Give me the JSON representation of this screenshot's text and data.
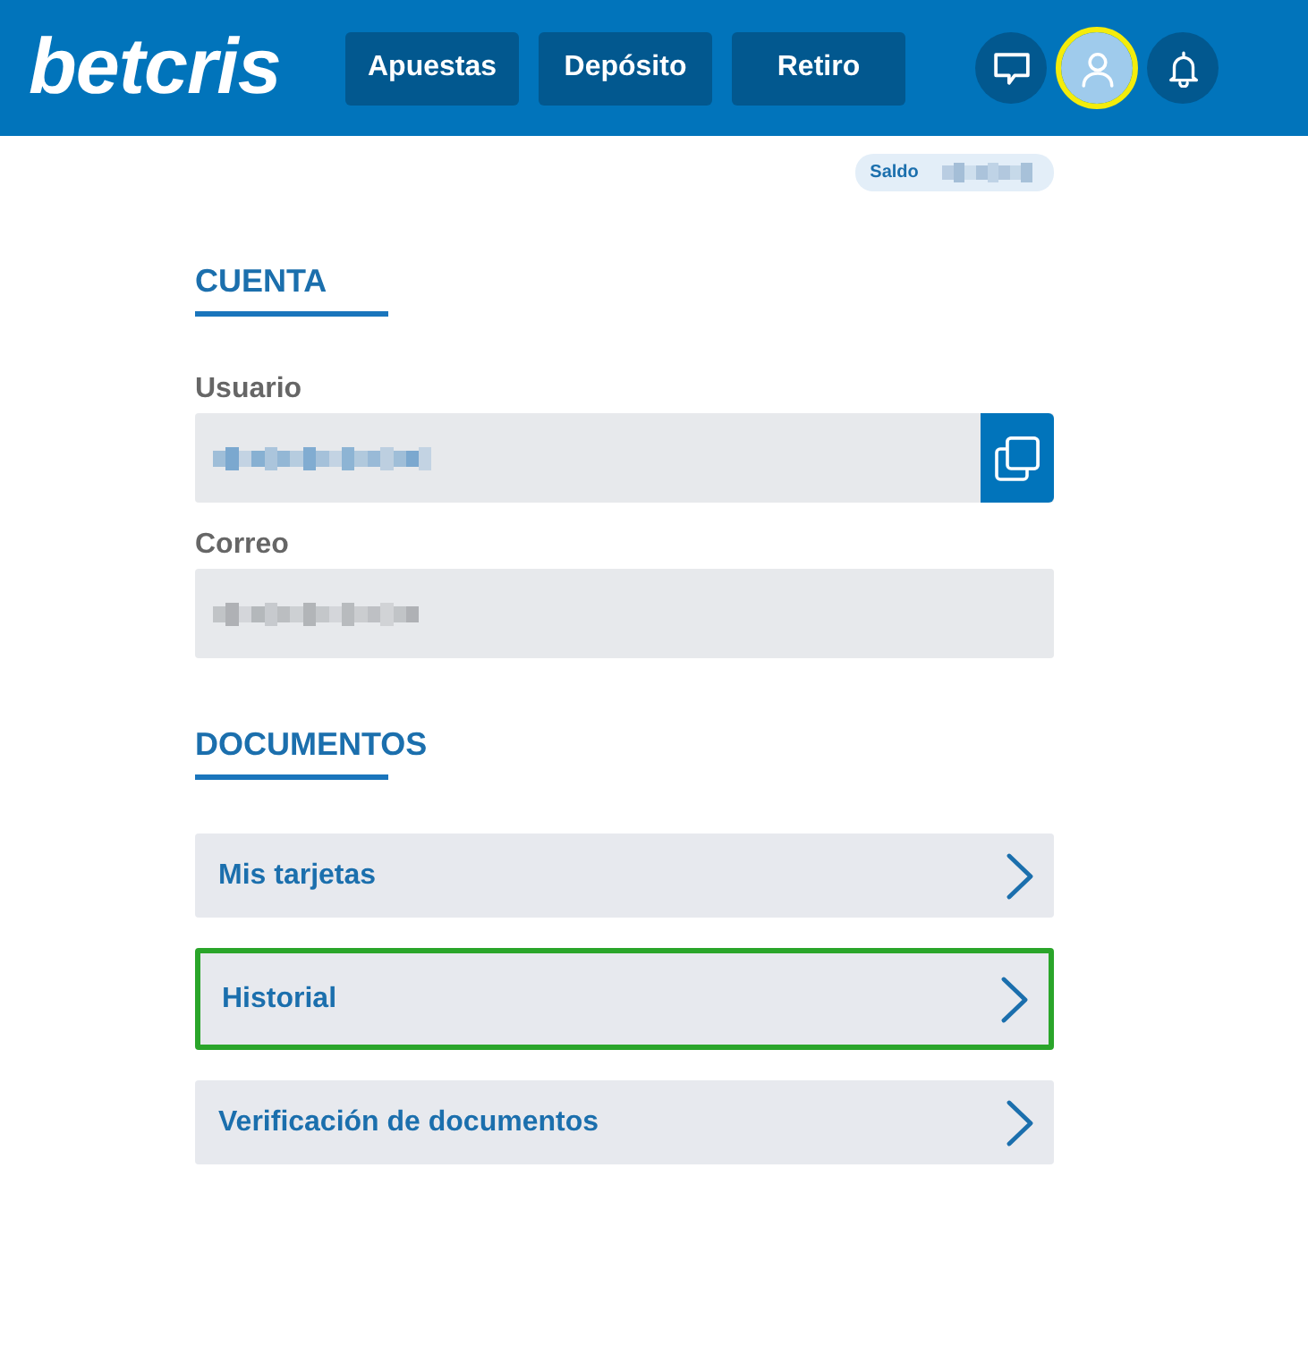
{
  "header": {
    "logo": "betcris",
    "nav_buttons": [
      {
        "label": "Apuestas"
      },
      {
        "label": "Depósito"
      },
      {
        "label": "Retiro"
      }
    ],
    "icon_buttons": [
      {
        "kind": "chat",
        "selected": false,
        "highlighted": false
      },
      {
        "kind": "profile",
        "selected": true,
        "highlighted": true
      },
      {
        "kind": "bell",
        "selected": false,
        "highlighted": false
      }
    ]
  },
  "balance": {
    "label": "Saldo",
    "redacted": true
  },
  "account": {
    "heading": "CUENTA",
    "fields": [
      {
        "label": "Usuario",
        "redacted": true,
        "copy_button": true
      },
      {
        "label": "Correo",
        "redacted": true,
        "copy_button": false
      }
    ]
  },
  "documents": {
    "heading": "DOCUMENTOS",
    "items": [
      {
        "label": "Mis tarjetas",
        "highlighted": false
      },
      {
        "label": "Historial",
        "highlighted": true
      },
      {
        "label": "Verificación de documentos",
        "highlighted": false
      }
    ]
  }
}
